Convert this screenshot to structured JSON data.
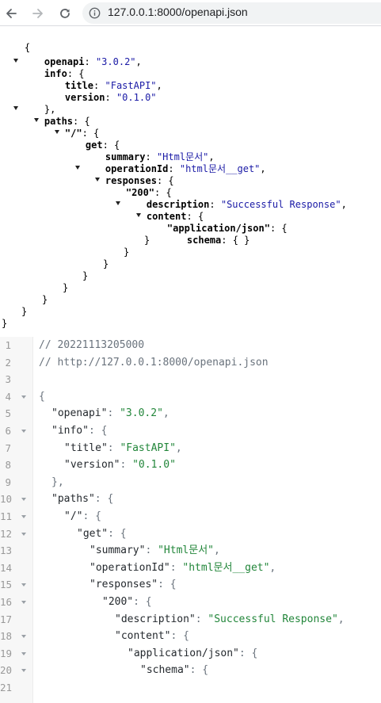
{
  "browser": {
    "url": "127.0.0.1:8000/openapi.json",
    "icons": {
      "back": "arrow-left-icon",
      "forward": "arrow-right-icon",
      "reload": "reload-icon",
      "site_info": "info-circle-icon"
    }
  },
  "viewer_lines": [
    "{",
    "openapi: \"3.0.2\",",
    "info: {",
    "title: \"FastAPI\",",
    "version: \"0.1.0\"",
    "},",
    "paths: {",
    "\"/\": {",
    "get: {",
    "summary: \"Html문서\",",
    "operationId: \"html문서__get\",",
    "responses: {",
    "\"200\": {",
    "description: \"Successful Response\",",
    "content: {",
    "\"application/json\": {",
    "schema: { }",
    "}",
    "}",
    "}",
    "}",
    "}",
    "}",
    "}",
    "}"
  ],
  "editor": {
    "lines": [
      {
        "n": "1",
        "text": "// 20221113205000"
      },
      {
        "n": "2",
        "text": "// http://127.0.0.1:8000/openapi.json"
      },
      {
        "n": "3",
        "text": ""
      },
      {
        "n": "4",
        "text": "{"
      },
      {
        "n": "5",
        "text": "\"openapi\": \"3.0.2\","
      },
      {
        "n": "6",
        "text": "\"info\": {"
      },
      {
        "n": "7",
        "text": "\"title\": \"FastAPI\","
      },
      {
        "n": "8",
        "text": "\"version\": \"0.1.0\""
      },
      {
        "n": "9",
        "text": "},"
      },
      {
        "n": "10",
        "text": "\"paths\": {"
      },
      {
        "n": "11",
        "text": "\"/\": {"
      },
      {
        "n": "12",
        "text": "\"get\": {"
      },
      {
        "n": "13",
        "text": "\"summary\": \"Html문서\","
      },
      {
        "n": "14",
        "text": "\"operationId\": \"html문서__get\","
      },
      {
        "n": "15",
        "text": "\"responses\": {"
      },
      {
        "n": "16",
        "text": "\"200\": {"
      },
      {
        "n": "17",
        "text": "\"description\": \"Successful Response\","
      },
      {
        "n": "18",
        "text": "\"content\": {"
      },
      {
        "n": "19",
        "text": "\"application/json\": {"
      },
      {
        "n": "20",
        "text": "\"schema\": {"
      },
      {
        "n": "21",
        "text": ""
      }
    ]
  },
  "colors": {
    "json_string": "#1a1aa6",
    "editor_string": "#22863a",
    "editor_comment": "#6a737d",
    "gutter_bg": "#f7f7f7"
  }
}
